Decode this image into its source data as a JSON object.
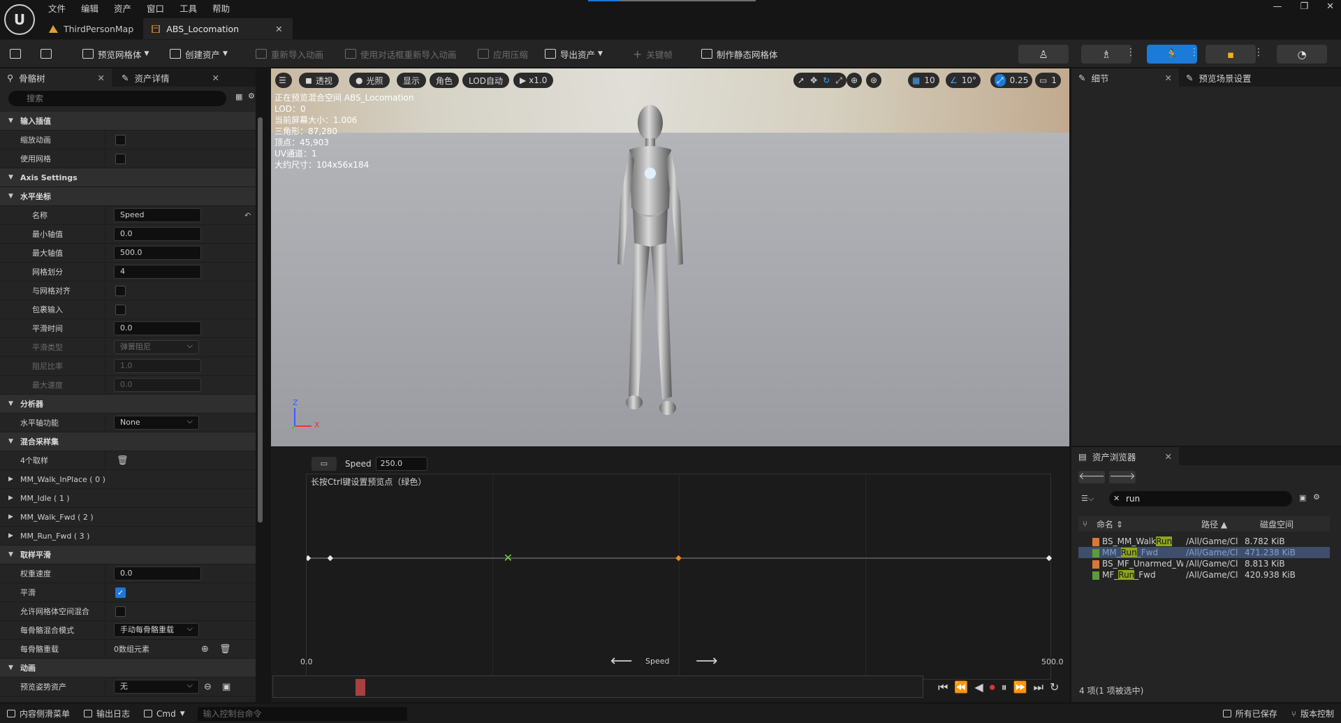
{
  "menu": [
    "文件",
    "编辑",
    "资产",
    "窗口",
    "工具",
    "帮助"
  ],
  "tabs": [
    {
      "label": "ThirdPersonMap"
    },
    {
      "label": "ABS_Locomation"
    }
  ],
  "toolbar": {
    "preview_mesh": "预览网格体",
    "create_asset": "创建资产",
    "reimport": "重新导入动画",
    "reimport_dialog": "使用对话框重新导入动画",
    "apply_compression": "应用压缩",
    "export_asset": "导出资产",
    "keyframe": "关键帧",
    "make_static_mesh": "制作静态网格体"
  },
  "left_panel": {
    "tab_skeleton": "骨骼树",
    "tab_asset_details": "资产详情",
    "search_placeholder": "搜索",
    "rows": [
      {
        "type": "cat",
        "label": "输入插值"
      },
      {
        "type": "chk",
        "label": "缩放动画",
        "checked": false
      },
      {
        "type": "chk",
        "label": "使用网格",
        "checked": false
      },
      {
        "type": "cat",
        "label": "Axis Settings"
      },
      {
        "type": "cat",
        "label": "水平坐标"
      },
      {
        "type": "val",
        "label": "名称",
        "value": "Speed",
        "sub": true
      },
      {
        "type": "val",
        "label": "最小轴值",
        "value": "0.0",
        "sub": true
      },
      {
        "type": "val",
        "label": "最大轴值",
        "value": "500.0",
        "sub": true
      },
      {
        "type": "val",
        "label": "网格划分",
        "value": "4",
        "sub": true
      },
      {
        "type": "chk",
        "label": "与网格对齐",
        "checked": false,
        "sub": true
      },
      {
        "type": "chk",
        "label": "包裹输入",
        "checked": false,
        "sub": true
      },
      {
        "type": "val",
        "label": "平滑时间",
        "value": "0.0",
        "sub": true
      },
      {
        "type": "dd",
        "label": "平滑类型",
        "value": "弹簧阻尼",
        "sub": true,
        "dim": true
      },
      {
        "type": "val",
        "label": "阻尼比率",
        "value": "1.0",
        "sub": true,
        "dim": true
      },
      {
        "type": "val",
        "label": "最大速度",
        "value": "0.0",
        "sub": true,
        "dim": true
      },
      {
        "type": "cat",
        "label": "分析器"
      },
      {
        "type": "dd",
        "label": "水平轴功能",
        "value": "None"
      },
      {
        "type": "cat",
        "label": "混合采样集"
      },
      {
        "type": "trash",
        "label": "4个取样"
      },
      {
        "type": "item",
        "label": "MM_Walk_InPlace ( 0 )"
      },
      {
        "type": "item",
        "label": "MM_Idle ( 1 )"
      },
      {
        "type": "item",
        "label": "MM_Walk_Fwd ( 2 )"
      },
      {
        "type": "item",
        "label": "MM_Run_Fwd ( 3 )"
      },
      {
        "type": "cat",
        "label": "取样平滑"
      },
      {
        "type": "val",
        "label": "权重速度",
        "value": "0.0"
      },
      {
        "type": "chk",
        "label": "平滑",
        "checked": true
      },
      {
        "type": "chk",
        "label": "允许网格体空间混合",
        "checked": false
      },
      {
        "type": "dd",
        "label": "每骨骼混合模式",
        "value": "手动每骨骼重载"
      },
      {
        "type": "arr",
        "label": "每骨骼重载",
        "value": "0数组元素"
      },
      {
        "type": "cat",
        "label": "动画"
      },
      {
        "type": "dd",
        "label": "预览姿势资产",
        "value": "无"
      }
    ]
  },
  "viewport": {
    "buttons": {
      "perspective": "透视",
      "lit": "光照",
      "show": "显示",
      "character": "角色",
      "lod": "LOD自动",
      "speed": "x1.0",
      "grid": "10",
      "angle": "10°",
      "scale": "0.25",
      "camera": "1"
    },
    "stats": [
      "正在预览混合空间 ABS_Locomation",
      "LOD：0",
      "当前屏幕大小：1.006",
      "三角形：87,280",
      "顶点：45,903",
      "UV通道：1",
      "大约尺寸：104x56x184"
    ],
    "axis_z": "Z",
    "axis_x": "X"
  },
  "blendspace": {
    "param_name": "Speed",
    "param_value": "250.0",
    "hint": "长按Ctrl键设置预览点（绿色）",
    "axis_name": "Speed",
    "axis_min": "0.0",
    "axis_max": "500.0",
    "samples": [
      0,
      15,
      250,
      500
    ],
    "preview_point": 135
  },
  "details": {
    "tab_details": "细节",
    "tab_preview_scene": "预览场景设置"
  },
  "asset_browser": {
    "title": "资产浏览器",
    "search_value": "run",
    "col_name": "命名",
    "col_path": "路径",
    "col_size": "磁盘空间",
    "rows": [
      {
        "pre": "BS_MM_Walk",
        "hl": "Run",
        "post": "",
        "path": "/All/Game/Cl",
        "size": "8.782 KiB",
        "color": "#d9783a",
        "selected": false
      },
      {
        "pre": "MM_",
        "hl": "Run",
        "post": "_Fwd",
        "path": "/All/Game/Cl",
        "size": "471.238 KiB",
        "color": "#5f9a3a",
        "selected": true
      },
      {
        "pre": "BS_MF_Unarmed_Walk",
        "hl": "",
        "post": "",
        "path": "/All/Game/Cl",
        "size": "8.813 KiB",
        "color": "#d9783a",
        "selected": false
      },
      {
        "pre": "MF_",
        "hl": "Run",
        "post": "_Fwd",
        "path": "/All/Game/Cl",
        "size": "420.938 KiB",
        "color": "#5f9a3a",
        "selected": false
      }
    ],
    "count": "4 项(1 项被选中)"
  },
  "statusbar": {
    "content_drawer": "内容侧滑菜单",
    "output_log": "输出日志",
    "cmd": "Cmd",
    "console_placeholder": "输入控制台命令",
    "all_saved": "所有已保存",
    "source_control": "版本控制"
  }
}
